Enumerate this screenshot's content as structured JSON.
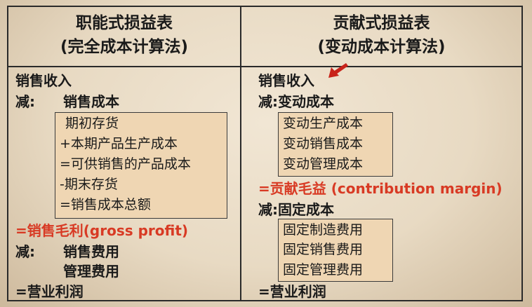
{
  "left": {
    "title": "职能式损益表",
    "subtitle": "(完全成本计算法)",
    "lines": {
      "sales": "销售收入",
      "less_label": "减:",
      "cogs": "销售成本",
      "box_items": [
        "期初存货",
        "+本期产品生产成本",
        "=可供销售的产品成本",
        "-期末存货",
        "=销售成本总额"
      ],
      "gross_profit": "=销售毛利(gross profit)",
      "less_label2": "减:",
      "selling_exp": "销售费用",
      "admin_exp": "管理费用",
      "operating_profit": "=营业利润"
    }
  },
  "right": {
    "title": "贡献式损益表",
    "subtitle": "(变动成本计算法)",
    "lines": {
      "sales": "销售收入",
      "less_variable": "减:变动成本",
      "variable_items": [
        "变动生产成本",
        "变动销售成本",
        "变动管理成本"
      ],
      "contribution_margin": "=贡献毛益 (contribution margin)",
      "less_fixed": "减:固定成本",
      "fixed_items": [
        "固定制造费用",
        "固定销售费用",
        "固定管理费用"
      ],
      "operating_profit": "=营业利润"
    }
  },
  "colors": {
    "highlight": "#d83a24",
    "box_fill": "#efd6b3"
  },
  "icons": {
    "pointer": "arrow-icon"
  }
}
